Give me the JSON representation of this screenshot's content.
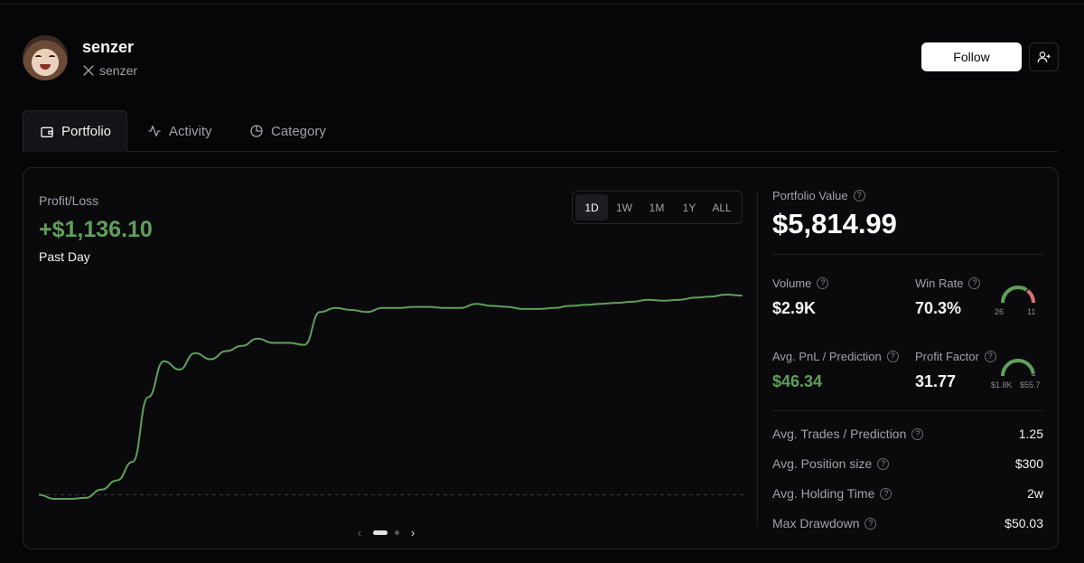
{
  "profile": {
    "name": "senzer",
    "handle": "senzer",
    "follow_label": "Follow"
  },
  "tabs": [
    {
      "label": "Portfolio",
      "icon": "wallet-icon",
      "active": true
    },
    {
      "label": "Activity",
      "icon": "activity-icon",
      "active": false
    },
    {
      "label": "Category",
      "icon": "pie-chart-icon",
      "active": false
    }
  ],
  "pnl": {
    "label": "Profit/Loss",
    "value": "+$1,136.10",
    "period": "Past Day"
  },
  "ranges": [
    {
      "label": "1D",
      "active": true
    },
    {
      "label": "1W",
      "active": false
    },
    {
      "label": "1M",
      "active": false
    },
    {
      "label": "1Y",
      "active": false
    },
    {
      "label": "ALL",
      "active": false
    }
  ],
  "colors": {
    "positive": "#5fa05a",
    "negative": "#d9736d",
    "gauge_track": "#3a3a40"
  },
  "chart_data": {
    "type": "line",
    "y": [
      0,
      -4,
      -4,
      -3,
      5,
      14,
      32,
      95,
      130,
      122,
      138,
      132,
      140,
      145,
      152,
      148,
      148,
      146,
      178,
      182,
      180,
      178,
      182,
      182,
      183,
      183,
      182,
      182,
      186,
      184,
      183,
      181,
      181,
      182,
      184,
      185,
      186,
      187,
      188,
      190,
      189,
      190,
      192,
      193,
      195,
      194
    ],
    "baseline": 0
  },
  "stats": {
    "portfolio_value_label": "Portfolio Value",
    "portfolio_value": "$5,814.99",
    "volume_label": "Volume",
    "volume": "$2.9K",
    "win_rate_label": "Win Rate",
    "win_rate": "70.3%",
    "wins": "26",
    "losses": "11",
    "avg_pnl_label": "Avg. PnL / Prediction",
    "avg_pnl": "$46.34",
    "profit_factor_label": "Profit Factor",
    "profit_factor": "31.77",
    "gross_profit": "$1.8K",
    "gross_loss": "$55.7",
    "rows": [
      {
        "label": "Avg. Trades / Prediction",
        "value": "1.25"
      },
      {
        "label": "Avg. Position size",
        "value": "$300"
      },
      {
        "label": "Avg. Holding Time",
        "value": "2w"
      },
      {
        "label": "Max Drawdown",
        "value": "$50.03"
      }
    ]
  }
}
